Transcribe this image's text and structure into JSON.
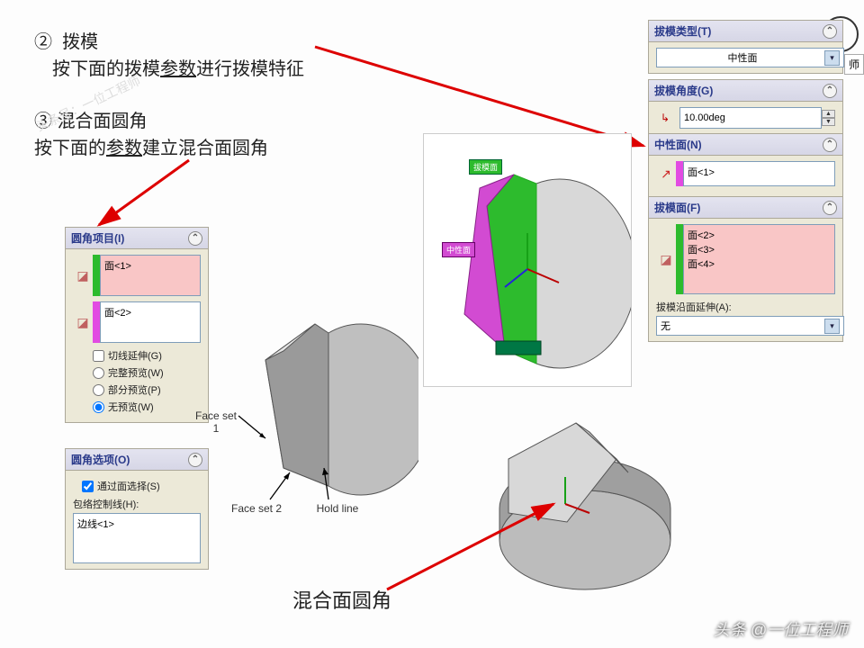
{
  "instructions": {
    "step2_num": "②",
    "step2_title": "拨模",
    "step2_text_a": "按下面的拨模",
    "step2_text_u": "参数",
    "step2_text_b": "进行拨模特征",
    "step3_num": "③",
    "step3_title": "混合面圆角",
    "step3_text_a": "按下面的",
    "step3_text_u": "参数",
    "step3_text_b": "建立混合面圆角"
  },
  "watermark": "头条号：一位工程师",
  "partial_badge": "师",
  "left_panel": {
    "items_header": "圆角项目(I)",
    "face1": "面<1>",
    "face2": "面<2>",
    "chk_tangent": "切线延伸(G)",
    "opt_full": "完整预览(W)",
    "opt_part": "部分预览(P)",
    "opt_none": "无预览(W)",
    "options_header": "圆角选项(O)",
    "chk_face_sel": "通过面选择(S)",
    "hold_label": "包络控制线(H):",
    "edge1": "边线<1>"
  },
  "right_panel": {
    "type_header": "拔模类型(T)",
    "type_value": "中性面",
    "angle_header": "拔模角度(G)",
    "angle_value": "10.00deg",
    "neutral_header": "中性面(N)",
    "neutral_face": "面<1>",
    "faces_header": "拔模面(F)",
    "faces": [
      "面<2>",
      "面<3>",
      "面<4>"
    ],
    "extend_label": "拔模沿面延伸(A):",
    "extend_value": "无"
  },
  "center": {
    "faceset1": "Face set 1",
    "faceset2": "Face set 2",
    "holdline": "Hold line",
    "topright_label1": "拔模面",
    "topright_label2": "中性面",
    "bottom_annot": "混合面圆角"
  },
  "credit": "头条 @一位工程师"
}
